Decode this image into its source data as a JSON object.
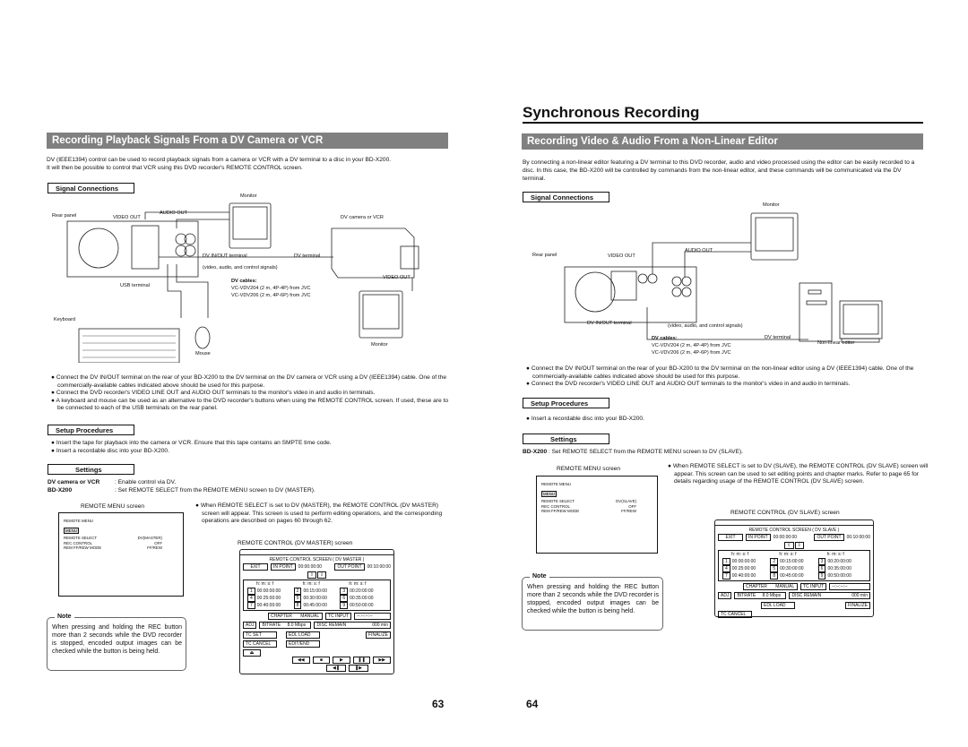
{
  "page_title": "Synchronous Recording",
  "left": {
    "banner": "Recording Playback Signals From a DV Camera or VCR",
    "intro": [
      "DV (IEEE1394) control can be used to record playback signals from a camera or VCR with a DV terminal to a disc in your BD-X200.",
      "It will then be possible to control that VCR using this DVD recorder's REMOTE CONTROL screen."
    ],
    "signal_connections": "Signal Connections",
    "diagram": {
      "monitor": "Monitor",
      "rear_panel": "Rear panel",
      "video_out": "VIDEO OUT",
      "audio_out": "AUDIO OUT",
      "camera": "DV camera or VCR",
      "dv_inout": "DV IN/OUT terminal",
      "dv_terminal": "DV terminal",
      "signals": "(video, audio, and control signals)",
      "cam_video_out": "VIDEO OUT",
      "usb": "USB terminal",
      "cables_title": "DV cables:",
      "cable1": "VC-VDV204 (2 m, 4P-4P) from JVC",
      "cable2": "VC-VDV206 (2 m, 4P-6P) from JVC",
      "keyboard": "Keyboard",
      "mouse": "Mouse",
      "monitor2": "Monitor"
    },
    "bullets": [
      "Connect the DV IN/OUT terminal on the rear of your BD-X200 to the DV terminal on the DV camera or VCR using a DV (IEEE1394) cable. One of the commercially-available cables indicated above should be used for this purpose.",
      "Connect the DVD recorder's VIDEO LINE OUT and AUDIO OUT terminals to the monitor's video in and audio in terminals.",
      "A keyboard and mouse can be used as an alternative to the DVD recorder's buttons when using the REMOTE CONTROL screen. If used, these are to be connected to each of the USB terminals on the rear panel."
    ],
    "setup_title": "Setup Procedures",
    "setup": [
      "Insert the tape for playback into the camera or VCR. Ensure that this tape contains an SMPTE time code.",
      "Insert a recordable disc into your BD-X200."
    ],
    "settings_title": "Settings",
    "settings": [
      {
        "k": "DV camera or VCR",
        "v": ": Enable control via DV."
      },
      {
        "k": "BD-X200",
        "v": ": Set REMOTE SELECT from the REMOTE MENU screen to DV (MASTER)."
      }
    ],
    "menu_caption": "REMOTE MENU screen",
    "menu": {
      "title": "REMOTE MENU",
      "tab": "MENU",
      "rows": [
        [
          "REMOTE SELECT",
          "DV(MASTER)"
        ],
        [
          "REC CONTROL",
          "OFF"
        ],
        [
          "REM FF/REW MODE",
          "FF/REW"
        ]
      ]
    },
    "note_title": "Note",
    "note": "When pressing and holding the REC button more than 2 seconds while the DVD recorder is stopped, encoded output images can be checked while the button is being held.",
    "rc_bullet": "When REMOTE SELECT is set to DV (MASTER), the REMOTE CONTROL (DV MASTER) screen will appear. This screen is used to perform editing operations, and the corresponding operations are described on pages 60 through 62.",
    "rc_caption": "REMOTE CONTROL (DV MASTER) screen",
    "rc": {
      "title": "REMOTE CONTROL SCREEN  ( DV MASTER )",
      "exit": "EXIT",
      "in_point": "IN POINT",
      "in_val": "00:00:00:00",
      "out_point": "OUT POINT",
      "out_val": "00:10:00:00",
      "hdr": "h: m: s: f",
      "times": [
        "00:00:00:00",
        "00:15:00:00",
        "00:20:00:00",
        "00:25:00:00",
        "00:30:00:00",
        "00:35:00:00",
        "00:40:00:00",
        "00:45:00:00",
        "00:50:00:00"
      ],
      "chapter": "CHAPTER",
      "manual": "MANUAL",
      "tc_input": "TC INPUT",
      "tc_val": "--:--:--:--",
      "adj": "ADJ",
      "bitrate": "BITRATE",
      "bitrate_val": "8.0 Mbps",
      "disc_remain": "DISC REMAIN",
      "disc_val": "000 min",
      "tc_set": "TC SET",
      "edl_load": "EDL LOAD",
      "finalize": "FINALIZE",
      "tc_cancel": "TC CANCEL",
      "edit_end": "EDIT/END",
      "eject": "⏏",
      "transport": [
        "◀◀",
        "■",
        "▶",
        "❚❚",
        "▶▶"
      ],
      "step": [
        "◀❚",
        "❚▶"
      ]
    },
    "page_number": "63"
  },
  "right": {
    "banner": "Recording Video & Audio From a Non-Linear Editor",
    "intro": "By connecting a non-linear editor featuring a DV terminal to this DVD recorder, audio and video processed using the editor can be easily recorded to a disc. In this case, the BD-X200 will be controlled by commands from the non-linear editor, and these commands will be communicated via the DV terminal.",
    "signal_connections": "Signal Connections",
    "diagram": {
      "monitor": "Monitor",
      "rear_panel": "Rear panel",
      "video_out": "VIDEO OUT",
      "audio_out": "AUDIO OUT",
      "dv_inout": "DV IN/OUT terminal",
      "signals": "(video, audio, and control signals)",
      "cables_title": "DV cables:",
      "cable1": "VC-VDV204 (2 m, 4P-4P) from JVC",
      "cable2": "VC-VDV206 (2 m, 4P-6P) from JVC",
      "dv_terminal": "DV terminal",
      "editor": "Non-linear editor"
    },
    "bullets": [
      "Connect the DV IN/OUT terminal on the rear of your BD-X200 to the DV terminal on the non-linear editor using a DV (IEEE1394) cable. One of the commercially-available cables indicated above should be used for this purpose.",
      "Connect the DVD recorder's VIDEO LINE OUT and AUDIO OUT terminals to the monitor's video in and audio in terminals."
    ],
    "setup_title": "Setup Procedures",
    "setup": [
      "Insert a recordable disc into your BD-X200."
    ],
    "settings_title": "Settings",
    "settings": [
      {
        "k": "BD-X200",
        "v": " :  Set REMOTE SELECT from the REMOTE MENU screen to DV (SLAVE)."
      }
    ],
    "menu_caption": "REMOTE MENU screen",
    "menu": {
      "title": "REMOTE MENU",
      "tab": "MENU",
      "rows": [
        [
          "REMOTE SELECT",
          "DV(SLAVE)"
        ],
        [
          "REC CONTROL",
          "OFF"
        ],
        [
          "REM FF/REW MODE",
          "FF/REW"
        ]
      ]
    },
    "note_title": "Note",
    "note": "When pressing and holding the REC button more than 2 seconds while the DVD recorder is stopped, encoded output images can be checked while the button is being held.",
    "rc_bullet": "When REMOTE SELECT is set to DV (SLAVE), the REMOTE CONTROL (DV SLAVE) screen will appear. This screen can be used to set editing points and chapter marks. Refer to page 65 for details regarding usage of the REMOTE CONTROL (DV SLAVE)  screen.",
    "rc_caption": "REMOTE CONTROL (DV SLAVE) screen",
    "rc": {
      "title": "REMOTE CONTROL SCREEN  ( DV SLAVE )",
      "exit": "EXIT",
      "in_point": "IN POINT",
      "in_val": "00:00:00:00",
      "out_point": "OUT POINT",
      "out_val": "00:10:00:00",
      "hdr": "h: m: s: f",
      "times": [
        "00:00:00:00",
        "00:15:00:00",
        "00:20:00:00",
        "00:25:00:00",
        "00:30:00:00",
        "00:35:00:00",
        "00:40:00:00",
        "00:45:00:00",
        "00:50:00:00"
      ],
      "chapter": "CHAPTER",
      "manual": "MANUAL",
      "tc_input": "TC INPUT",
      "tc_val": "--:--:--:--",
      "adj": "ADJ",
      "bitrate": "BITRATE",
      "bitrate_val": "8.0 Mbps",
      "disc_remain": "DISC REMAIN",
      "disc_val": "000 min",
      "edl_load": "EDL LOAD",
      "finalize": "FINALIZE",
      "tc_cancel": "TC CANCEL"
    },
    "page_number": "64"
  }
}
